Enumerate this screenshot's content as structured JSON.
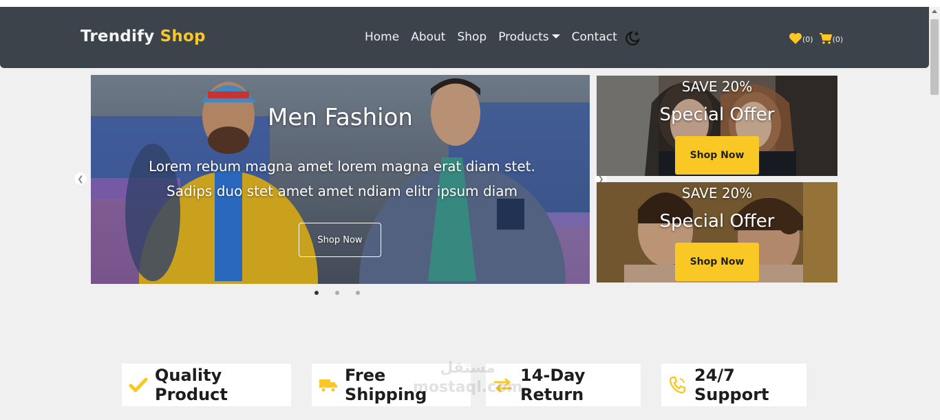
{
  "brand": {
    "part1": "Trendify",
    "part2": "Shop"
  },
  "nav": {
    "items": [
      {
        "label": "Home"
      },
      {
        "label": "About"
      },
      {
        "label": "Shop"
      },
      {
        "label": "Products",
        "dropdown": true
      },
      {
        "label": "Contact"
      }
    ],
    "theme_toggle_icon": "moon-icon"
  },
  "counters": {
    "wishlist": "(0)",
    "cart": "(0)"
  },
  "carousel": {
    "title": "Men Fashion",
    "description": "Lorem rebum magna amet lorem magna erat diam stet. Sadips duo stet amet amet ndiam elitr ipsum diam",
    "button": "Shop Now",
    "slides_count": 3,
    "active_index": 0
  },
  "offers": [
    {
      "save": "SAVE 20%",
      "title": "Special Offer",
      "button": "Shop Now"
    },
    {
      "save": "SAVE 20%",
      "title": "Special Offer",
      "button": "Shop Now"
    }
  ],
  "features": [
    {
      "label": "Quality Product",
      "icon": "check-icon"
    },
    {
      "label": "Free Shipping",
      "icon": "truck-icon"
    },
    {
      "label": "14-Day Return",
      "icon": "exchange-icon"
    },
    {
      "label": "24/7 Support",
      "icon": "phone-icon"
    }
  ],
  "colors": {
    "accent": "#f9c825",
    "navbar": "#3c434b",
    "page_bg": "#f0f0f0"
  }
}
